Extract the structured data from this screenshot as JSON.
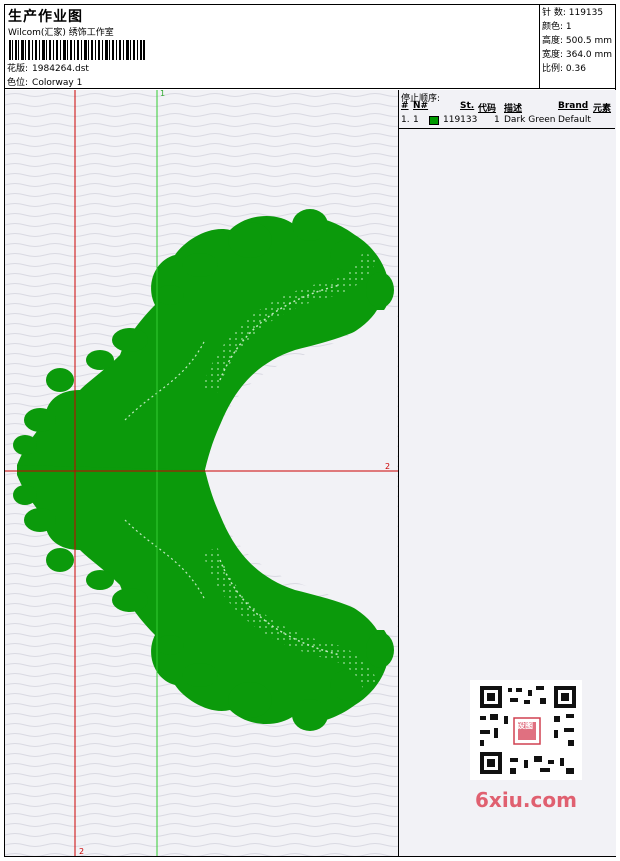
{
  "header": {
    "title": "生产作业图",
    "company": "Wilcom(汇家) 绣饰工作室",
    "design_label": "花版:",
    "design_value": "1984264.dst",
    "colorway_label": "色位:",
    "colorway_value": "Colorway 1"
  },
  "stats": {
    "stitches": "针 数: 119135",
    "colors": "颜色: 1",
    "height": "高度: 500.5 mm",
    "width": "宽度: 364.0 mm",
    "scale": "比例: 0.36"
  },
  "guides": {
    "v1": "1",
    "v2": "2",
    "h2": "2"
  },
  "stop_sequence": {
    "title": "停止顺序:",
    "columns": [
      "#",
      "N#",
      "St.",
      "代码",
      "描述",
      "Brand",
      "元素"
    ],
    "rows": [
      {
        "idx": "1.",
        "n": "1",
        "st": "119133",
        "code": "1",
        "desc": "Dark Green",
        "brand": "Default",
        "color": "#009900"
      }
    ]
  },
  "watermark": {
    "text": "6xiu.com",
    "stamp": "设图"
  },
  "colors": {
    "embroidery": "#0b9a0b",
    "guide_red": "#cc0000",
    "guide_green": "#33cc33"
  }
}
